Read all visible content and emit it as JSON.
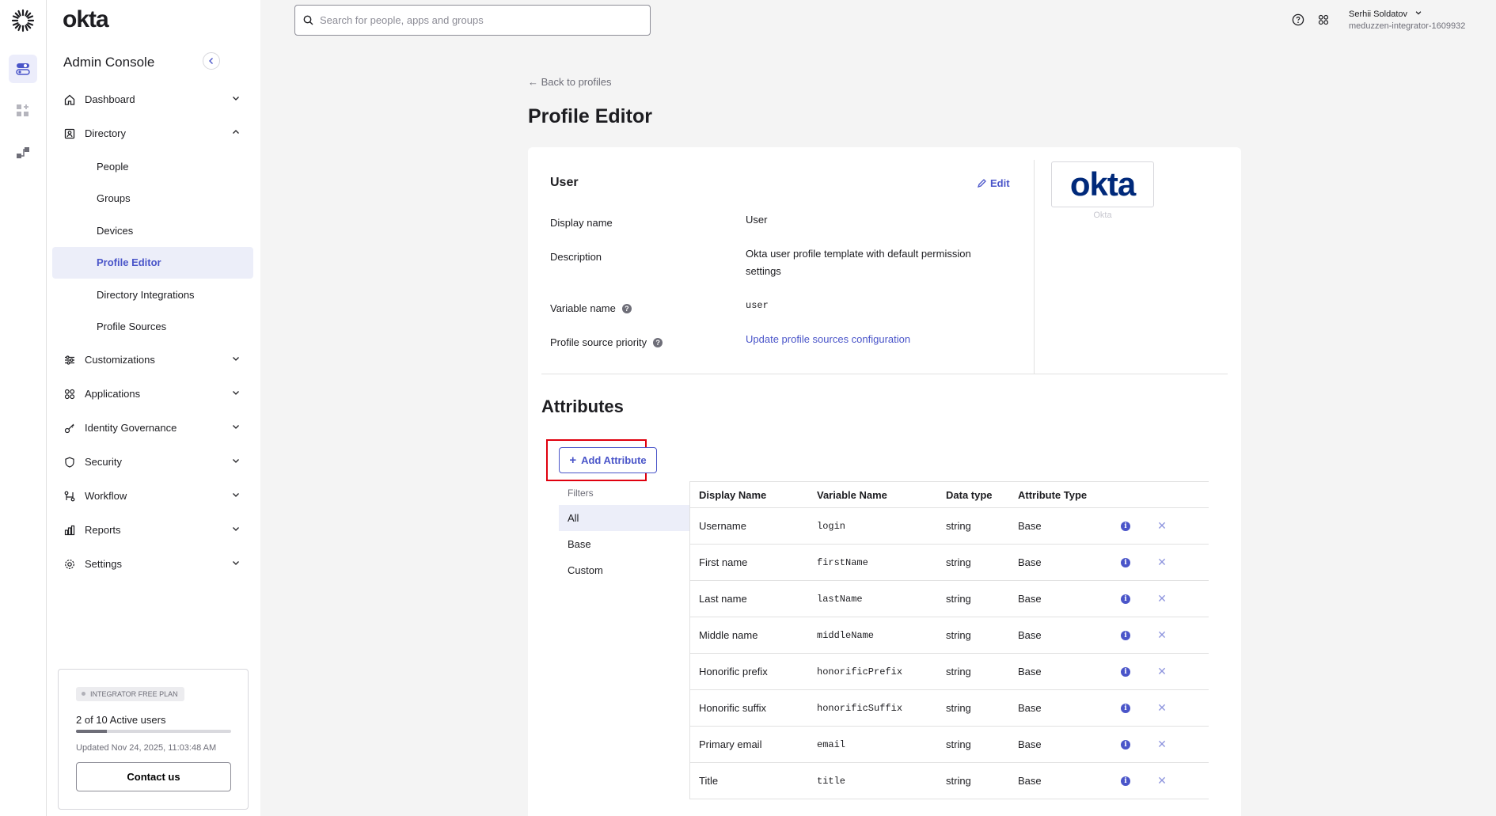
{
  "brand": "okta",
  "sidebar": {
    "title": "Admin Console",
    "nav": [
      {
        "label": "Dashboard",
        "icon": "home-icon"
      },
      {
        "label": "Directory",
        "icon": "directory-icon"
      },
      {
        "label": "Customizations",
        "icon": "sliders-icon"
      },
      {
        "label": "Applications",
        "icon": "apps-grid-icon"
      },
      {
        "label": "Identity Governance",
        "icon": "key-icon"
      },
      {
        "label": "Security",
        "icon": "shield-icon"
      },
      {
        "label": "Workflow",
        "icon": "workflow-icon"
      },
      {
        "label": "Reports",
        "icon": "bar-chart-icon"
      },
      {
        "label": "Settings",
        "icon": "gear-icon"
      }
    ],
    "directory_items": [
      "People",
      "Groups",
      "Devices",
      "Profile Editor",
      "Directory Integrations",
      "Profile Sources"
    ],
    "active_item": "Profile Editor",
    "plan": {
      "badge": "INTEGRATOR FREE PLAN",
      "users": "2 of 10 Active users",
      "usage": 0.2,
      "updated": "Updated Nov 24, 2025, 11:03:48 AM",
      "contact": "Contact us"
    }
  },
  "header": {
    "search_placeholder": "Search for people, apps and groups",
    "user_name": "Serhii Soldatov",
    "org": "meduzzen-integrator-1609932"
  },
  "main": {
    "back": "← Back to profiles",
    "title": "Profile Editor",
    "profile": {
      "name": "User",
      "edit": "Edit",
      "display_name_label": "Display name",
      "display_name": "User",
      "description_label": "Description",
      "description": "Okta user profile template with default permission settings",
      "variable_label": "Variable name",
      "variable": "user",
      "priority_label": "Profile source priority",
      "priority_link": "Update profile sources configuration",
      "logo_text": "okta",
      "logo_caption": "Okta"
    },
    "attributes": {
      "title": "Attributes",
      "add_button": "Add Attribute",
      "filters_label": "Filters",
      "filters": [
        "All",
        "Base",
        "Custom"
      ],
      "columns": [
        "Display Name",
        "Variable Name",
        "Data type",
        "Attribute Type"
      ],
      "rows": [
        {
          "display": "Username",
          "variable": "login",
          "type": "string",
          "attr": "Base"
        },
        {
          "display": "First name",
          "variable": "firstName",
          "type": "string",
          "attr": "Base"
        },
        {
          "display": "Last name",
          "variable": "lastName",
          "type": "string",
          "attr": "Base"
        },
        {
          "display": "Middle name",
          "variable": "middleName",
          "type": "string",
          "attr": "Base"
        },
        {
          "display": "Honorific prefix",
          "variable": "honorificPrefix",
          "type": "string",
          "attr": "Base"
        },
        {
          "display": "Honorific suffix",
          "variable": "honorificSuffix",
          "type": "string",
          "attr": "Base"
        },
        {
          "display": "Primary email",
          "variable": "email",
          "type": "string",
          "attr": "Base"
        },
        {
          "display": "Title",
          "variable": "title",
          "type": "string",
          "attr": "Base"
        }
      ]
    }
  },
  "colors": {
    "accent": "#4a55c9",
    "highlight": "#e0000e"
  }
}
